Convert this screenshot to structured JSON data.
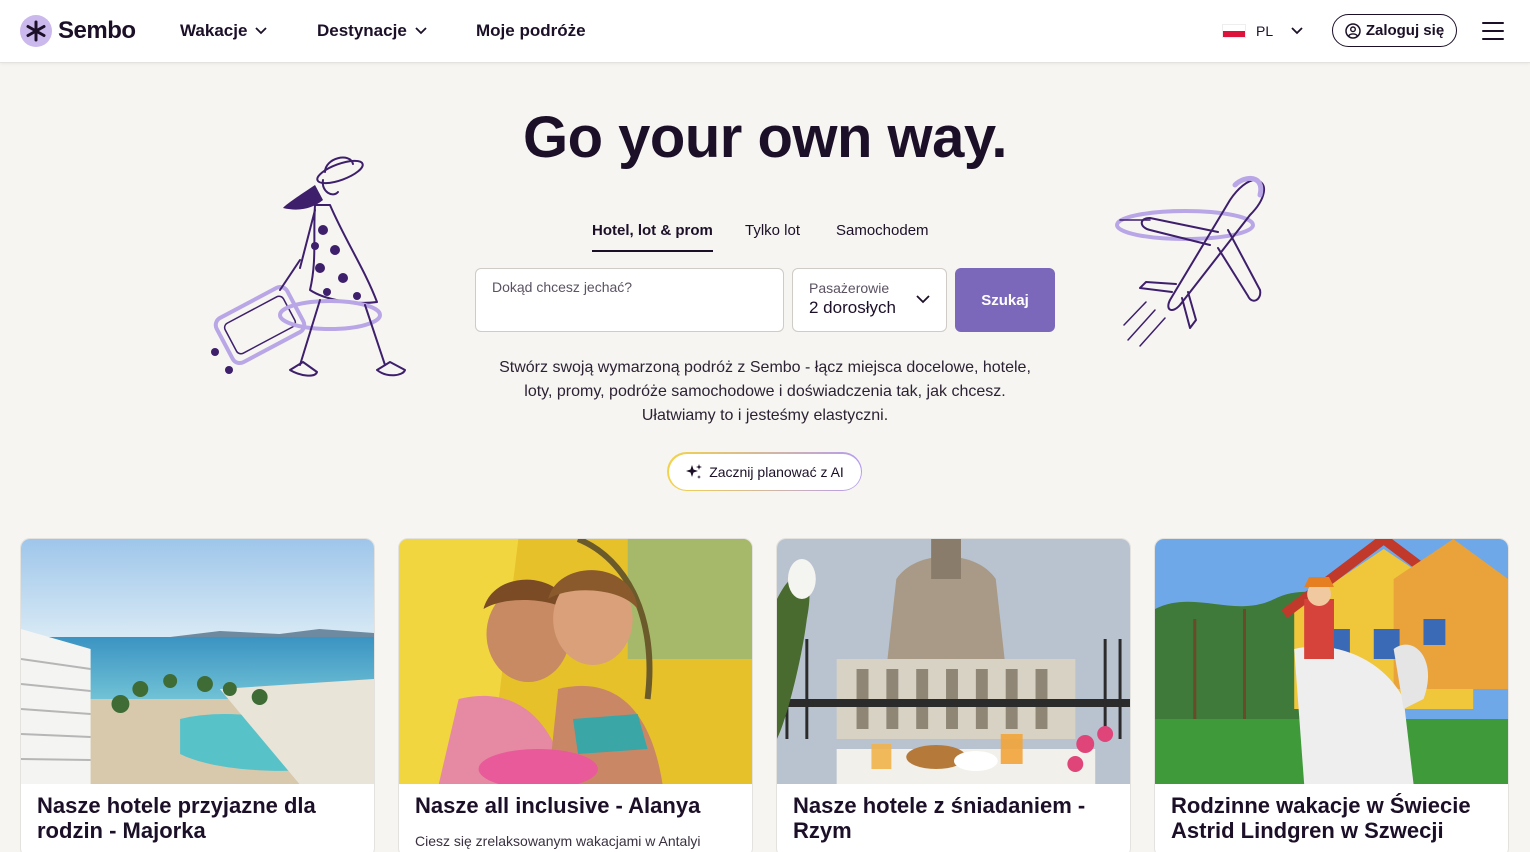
{
  "header": {
    "brand": "Sembo",
    "nav": [
      {
        "label": "Wakacje",
        "has_dropdown": true
      },
      {
        "label": "Destynacje",
        "has_dropdown": true
      },
      {
        "label": "Moje podróże",
        "has_dropdown": false
      }
    ],
    "language": "PL",
    "login_label": "Zaloguj się"
  },
  "hero": {
    "headline": "Go your own way.",
    "tabs": [
      {
        "label": "Hotel, lot & prom",
        "active": true
      },
      {
        "label": "Tylko lot",
        "active": false
      },
      {
        "label": "Samochodem",
        "active": false
      }
    ],
    "destination_placeholder": "Dokąd chcesz jechać?",
    "passengers_label": "Pasażerowie",
    "passengers_value": "2 dorosłych",
    "search_label": "Szukaj",
    "description": "Stwórz swoją wymarzoną podróż z Sembo - łącz miejsca docelowe, hotele, loty, promy, podróże samochodowe i doświadczenia tak, jak chcesz. Ułatwiamy to i jesteśmy elastyczni.",
    "ai_button_label": "Zacznij planować z AI"
  },
  "cards": [
    {
      "title": "Nasze hotele przyjazne dla rodzin - Majorka",
      "subtitle": ""
    },
    {
      "title": "Nasze all inclusive - Alanya",
      "subtitle": "Ciesz się zrelaksowanym wakacjami w Antalyi"
    },
    {
      "title": "Nasze hotele z śniadaniem - Rzym",
      "subtitle": ""
    },
    {
      "title": "Rodzinne wakacje w Świecie Astrid Lindgren w Szwecji",
      "subtitle": ""
    }
  ],
  "colors": {
    "brand_purple": "#7b68bb",
    "dark_text": "#1c1028",
    "background": "#f6f5f2",
    "illustration_light": "#b9a6e6",
    "illustration_dark": "#3d1f6b"
  },
  "icons": [
    "logo-asterisk-icon",
    "chevron-down-icon",
    "poland-flag-icon",
    "user-icon",
    "hamburger-menu-icon",
    "sparkle-icon"
  ]
}
